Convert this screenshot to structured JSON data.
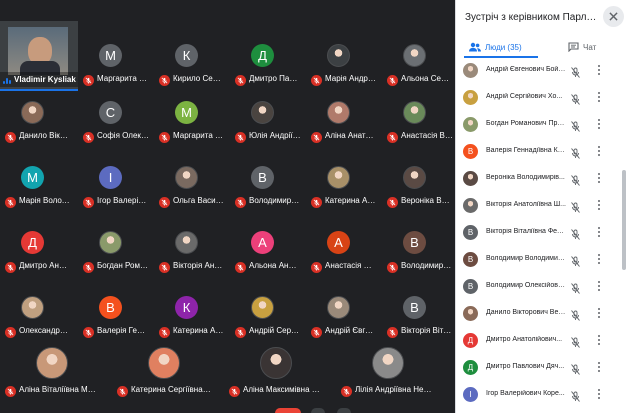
{
  "presenter": {
    "name": "Vladimir Kysliak",
    "avatar": "photo-man-suit"
  },
  "tiles": [
    {
      "name": "Маргарита Ол...",
      "initial": "М",
      "color": "#5f6368"
    },
    {
      "name": "Кирило Сергі...",
      "initial": "К",
      "color": "#5f6368"
    },
    {
      "name": "Дмитро Павл...",
      "initial": "Д",
      "color": "#1e8e3e"
    },
    {
      "name": "Марія Андріїв...",
      "avatar": "photo-girl",
      "color": "#3c4043"
    },
    {
      "name": "Альона Сергі...",
      "avatar": "photo-girl",
      "color": "#6b6f73"
    },
    {
      "name": "Данило Вікто...",
      "avatar": "photo-boy",
      "color": "#8a6a58"
    },
    {
      "name": "Софія Олекса...",
      "initial": "С",
      "color": "#5f6368"
    },
    {
      "name": "Маргарита Се...",
      "initial": "М",
      "color": "#7cb342"
    },
    {
      "name": "Юлія Андріївн...",
      "avatar": "photo-girl",
      "color": "#4a4440"
    },
    {
      "name": "Аліна Анатолі...",
      "avatar": "photo-girl",
      "color": "#b07a6a"
    },
    {
      "name": "Анастасія Віт...",
      "avatar": "photo-outdoor",
      "color": "#6a8a5a"
    },
    {
      "name": "Марія Володи...",
      "initial": "М",
      "color": "#12a4af"
    },
    {
      "name": "Ігор Валерійо...",
      "initial": "І",
      "color": "#5c6bc0"
    },
    {
      "name": "Ольга Василі...",
      "avatar": "photo-girl",
      "color": "#7a6a60"
    },
    {
      "name": "Володимир О...",
      "initial": "В",
      "color": "#5f6368"
    },
    {
      "name": "Катерина Анд...",
      "avatar": "photo-girl",
      "color": "#a89068"
    },
    {
      "name": "Вероніка Воло...",
      "avatar": "photo-girl",
      "color": "#5a4a44"
    },
    {
      "name": "Дмитро Анат...",
      "initial": "Д",
      "color": "#e53935"
    },
    {
      "name": "Богдан Рома...",
      "avatar": "photo-outdoor",
      "color": "#8a9a6a"
    },
    {
      "name": "Вікторія Анат...",
      "avatar": "photo-girl",
      "color": "#6a6a6a"
    },
    {
      "name": "Альона Андрії...",
      "initial": "А",
      "color": "#ec407a"
    },
    {
      "name": "Анастасія Юрі...",
      "initial": "А",
      "color": "#d84315"
    },
    {
      "name": "Володимир В...",
      "initial": "В",
      "color": "#6d4c41"
    },
    {
      "name": "Олександра Р...",
      "avatar": "photo-girl",
      "color": "#c0a080"
    },
    {
      "name": "Валерія Генна...",
      "initial": "В",
      "color": "#f4511e"
    },
    {
      "name": "Катерина Анат...",
      "initial": "К",
      "color": "#8e24aa"
    },
    {
      "name": "Андрій Сергій...",
      "avatar": "photo-outdoor",
      "color": "#c8a040"
    },
    {
      "name": "Андрій Євген...",
      "avatar": "photo-boy",
      "color": "#9a8a7a"
    },
    {
      "name": "Вікторія Вітал...",
      "initial": "В",
      "color": "#5f6368"
    },
    {
      "name": "Аліна Віталіївна Мельник",
      "avatar": "photo-girl",
      "color": "#c89878"
    },
    {
      "name": "Катерина Сергіївна Орло...",
      "avatar": "photo-girl",
      "color": "#e08060"
    },
    {
      "name": "Аліна Максимівна Мамче...",
      "avatar": "photo-girl",
      "color": "#3a3434"
    },
    {
      "name": "Лілія Андріївна Невідомс...",
      "avatar": "photo-girl",
      "color": "#8a8a8a"
    }
  ],
  "panel": {
    "title": "Зустріч з керівником Парламент...",
    "close_icon": "close-icon",
    "tab_people": "Люди (35)",
    "tab_chat": "Чат",
    "people": [
      {
        "name": "Андрій Євгенович Бойченко",
        "avatar": "photo",
        "color": "#9a8a7a"
      },
      {
        "name": "Андрій Сергійович Хо...",
        "avatar": "photo",
        "color": "#c8a040"
      },
      {
        "name": "Богдан Романович Пра...",
        "avatar": "photo",
        "color": "#8a9a6a"
      },
      {
        "name": "Валерія Геннадіївна Ка...",
        "initial": "В",
        "color": "#f4511e"
      },
      {
        "name": "Вероніка Володимирів...",
        "avatar": "photo",
        "color": "#5a4a44"
      },
      {
        "name": "Вікторія Анатоліївна Ш...",
        "avatar": "photo",
        "color": "#6a6a6a"
      },
      {
        "name": "Вікторія Віталіївна Федор...",
        "initial": "В",
        "color": "#5f6368"
      },
      {
        "name": "Володимир Володимир...",
        "initial": "В",
        "color": "#6d4c41"
      },
      {
        "name": "Володимир Олексійович...",
        "initial": "В",
        "color": "#5f6368"
      },
      {
        "name": "Данило Вікторович Вер...",
        "avatar": "photo",
        "color": "#8a6a58"
      },
      {
        "name": "Дмитро Анатолійович...",
        "initial": "Д",
        "color": "#e53935"
      },
      {
        "name": "Дмитро Павлович Дяч...",
        "initial": "Д",
        "color": "#1e8e3e"
      },
      {
        "name": "Ігор Валерійович Коре...",
        "initial": "І",
        "color": "#5c6bc0"
      }
    ]
  }
}
